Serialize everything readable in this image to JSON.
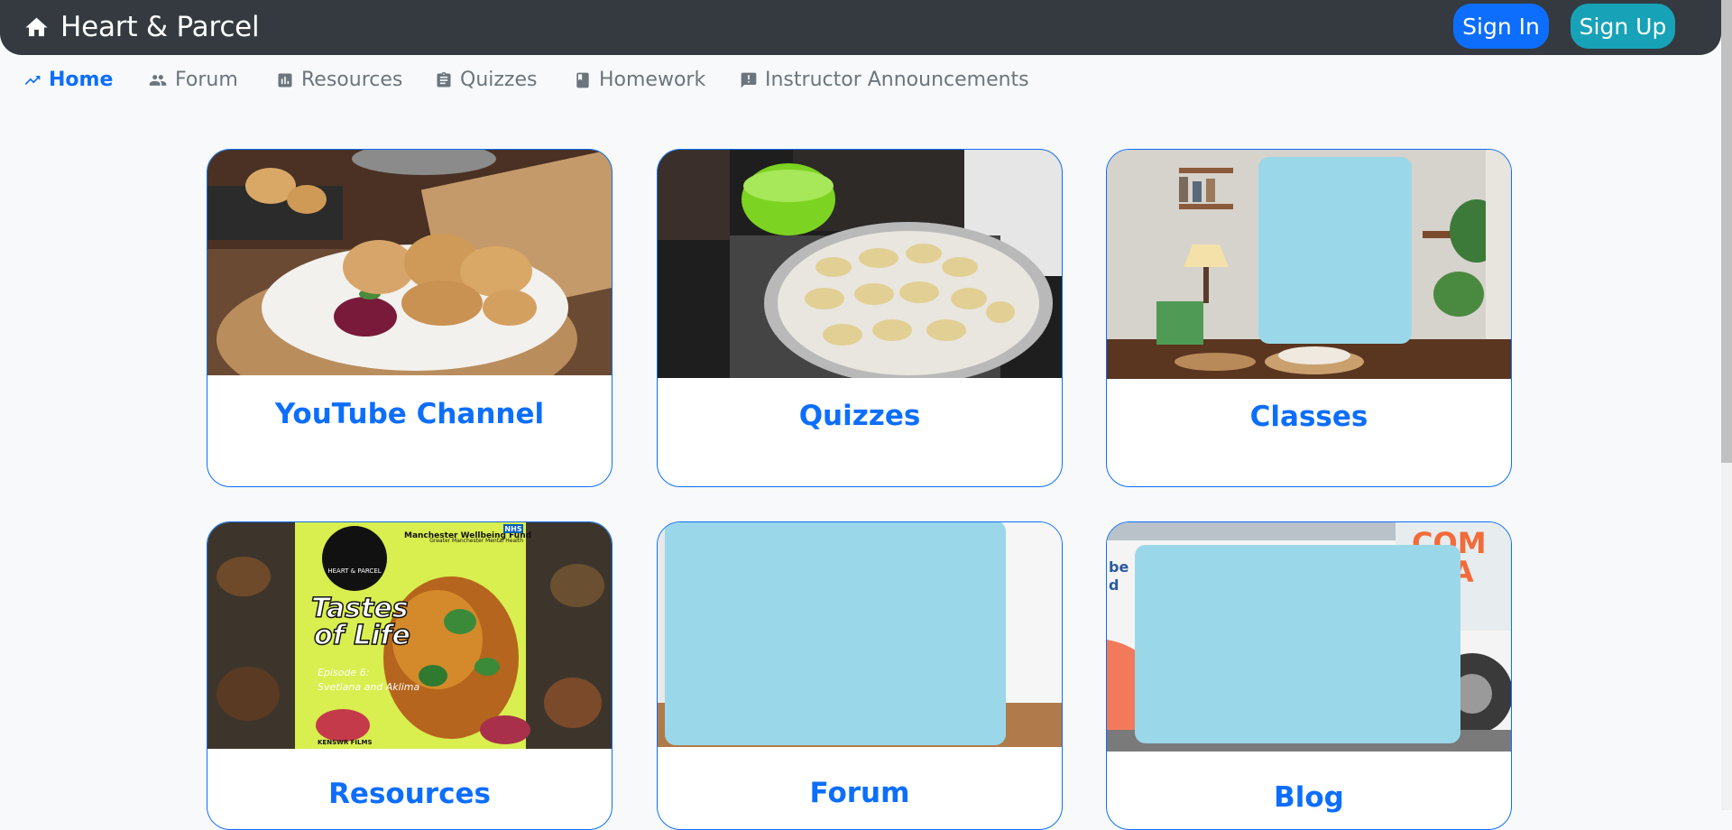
{
  "brand": {
    "title": "Heart & Parcel",
    "icon": "home-icon"
  },
  "auth": {
    "sign_in": "Sign In",
    "sign_up": "Sign Up"
  },
  "nav": {
    "items": [
      {
        "label": "Home",
        "icon": "trending-up-icon",
        "active": true
      },
      {
        "label": "Forum",
        "icon": "people-icon"
      },
      {
        "label": "Resources",
        "icon": "chart-icon"
      },
      {
        "label": "Quizzes",
        "icon": "clipboard-icon"
      },
      {
        "label": "Homework",
        "icon": "book-icon"
      },
      {
        "label": "Instructor Announcements",
        "icon": "announcement-icon"
      }
    ]
  },
  "cards": [
    {
      "title": "YouTube Channel",
      "image": "baked-pastries-with-beetroot-dip"
    },
    {
      "title": "Quizzes",
      "image": "dumplings-in-pan-on-stove"
    },
    {
      "title": "Classes",
      "image": "kitchen-room-with-lamp-and-plants"
    },
    {
      "title": "Resources",
      "image": "tastes-of-life-episode-poster",
      "poster": {
        "small_text": "HEART & PARCEL",
        "funder": "Manchester Wellbeing Fund",
        "nhs": "NHS",
        "nhs_sub": "Greater Manchester Mental Health",
        "headline_1": "Tastes",
        "headline_2": "of Life",
        "episode": "Episode 6:",
        "guests": "Svetlana and Aklima",
        "credit": "KENSWR FILMS"
      }
    },
    {
      "title": "Forum",
      "image": "workshop-whiteboard"
    },
    {
      "title": "Blog",
      "image": "community-van",
      "van_text_1": "COM",
      "van_text_2": "PLA",
      "side_text_1": "be",
      "side_text_2": "d"
    }
  ],
  "colors": {
    "accent": "#0d6efd",
    "topbar": "#343a40",
    "signup": "#17a2b8",
    "redaction": "#9ad8e9"
  }
}
